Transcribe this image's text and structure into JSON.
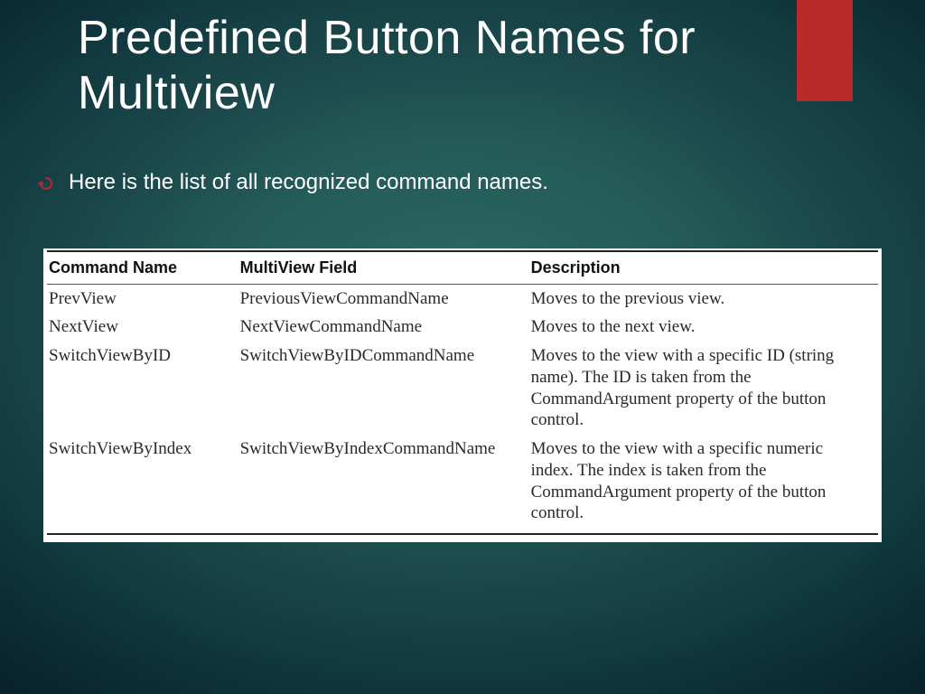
{
  "title": "Predefined Button Names for Multiview",
  "bullet": "Here is the list of all recognized command names.",
  "table": {
    "headers": [
      "Command Name",
      "MultiView Field",
      "Description"
    ],
    "rows": [
      {
        "cmd": "PrevView",
        "field": "PreviousViewCommandName",
        "desc": "Moves to the previous view."
      },
      {
        "cmd": "NextView",
        "field": "NextViewCommandName",
        "desc": "Moves to the next view."
      },
      {
        "cmd": "SwitchViewByID",
        "field": "SwitchViewByIDCommandName",
        "desc": "Moves to the view with a specific ID (string name). The ID is taken from the CommandArgument property of the button control."
      },
      {
        "cmd": "SwitchViewByIndex",
        "field": "SwitchViewByIndexCommandName",
        "desc": "Moves to the view with a specific numeric index. The index is taken from the CommandArgument property of the button control."
      }
    ]
  }
}
